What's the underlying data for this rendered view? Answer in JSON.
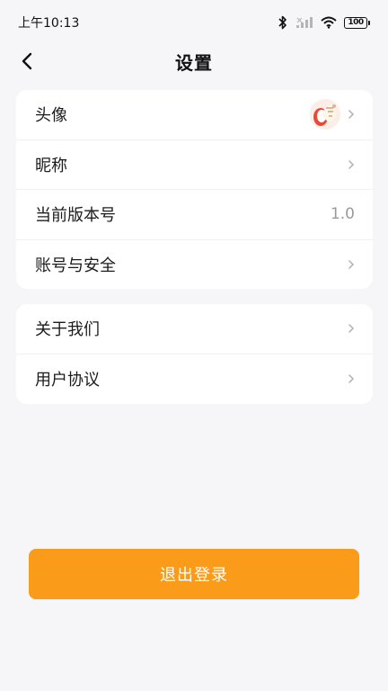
{
  "status_bar": {
    "time": "上午10:13",
    "battery": "100"
  },
  "header": {
    "title": "设置",
    "back_icon": "chevron-left-icon"
  },
  "settings_group_1": [
    {
      "label": "头像",
      "value": "",
      "has_avatar": true
    },
    {
      "label": "昵称",
      "value": ""
    },
    {
      "label": "当前版本号",
      "value": "1.0"
    },
    {
      "label": "账号与安全",
      "value": ""
    }
  ],
  "settings_group_2": [
    {
      "label": "关于我们",
      "value": ""
    },
    {
      "label": "用户协议",
      "value": ""
    }
  ],
  "logout": {
    "label": "退出登录",
    "color": "#fb9b1a"
  },
  "colors": {
    "background": "#f6f6f8",
    "card": "#ffffff",
    "accent": "#fb9b1a",
    "secondary_text": "#9a9a9a"
  }
}
